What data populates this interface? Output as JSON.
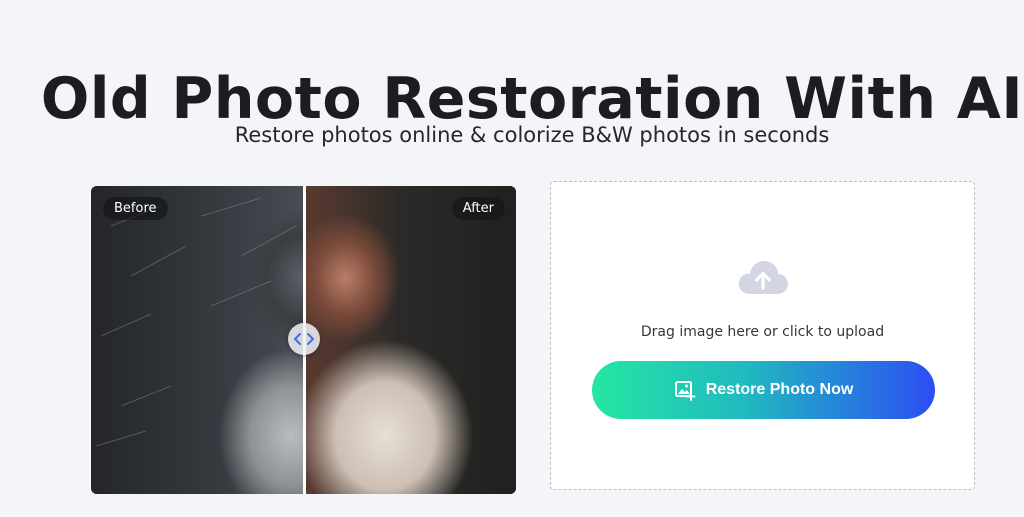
{
  "hero": {
    "title": "Old Photo Restoration With AI",
    "subtitle": "Restore photos online & colorize B&W photos in seconds"
  },
  "comparison": {
    "before_label": "Before",
    "after_label": "After",
    "slider_position": 0.5
  },
  "upload": {
    "hint": "Drag image here or click to upload",
    "cta_label": "Restore Photo Now",
    "cloud_icon": "cloud-upload-icon",
    "cta_icon": "add-image-icon"
  },
  "colors": {
    "background": "#f4f5f8",
    "cta_gradient_start": "#25e6a3",
    "cta_gradient_end": "#2d4df4",
    "cloud_icon": "#d3d5e2"
  }
}
